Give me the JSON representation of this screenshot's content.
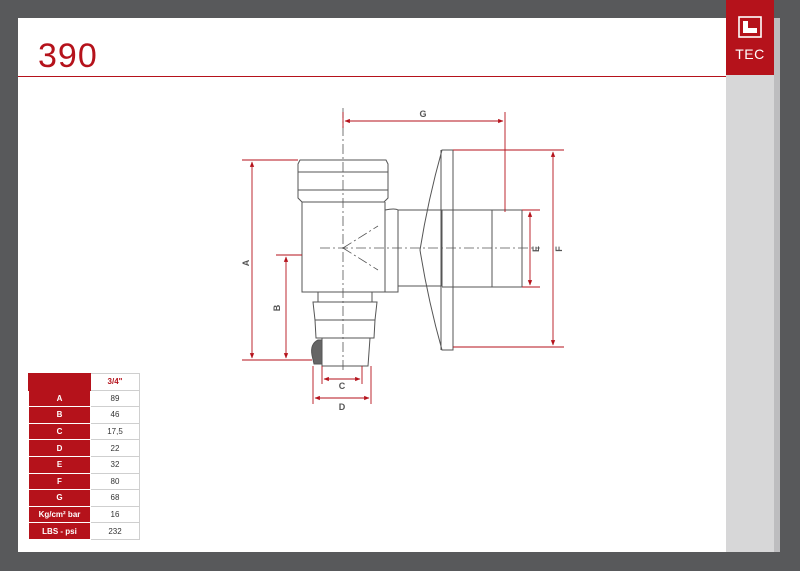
{
  "header": {
    "product_code": "390"
  },
  "brand": {
    "name": "TEC",
    "logo_icon": "tec-logo-icon"
  },
  "drawing": {
    "labels": {
      "A": "A",
      "B": "B",
      "C": "C",
      "D": "D",
      "E": "E",
      "F": "F",
      "G": "G"
    }
  },
  "spec_table": {
    "size_header": "3/4\"",
    "rows": [
      {
        "label": "A",
        "value": "89"
      },
      {
        "label": "B",
        "value": "46"
      },
      {
        "label": "C",
        "value": "17,5"
      },
      {
        "label": "D",
        "value": "22"
      },
      {
        "label": "E",
        "value": "32"
      },
      {
        "label": "F",
        "value": "80"
      },
      {
        "label": "G",
        "value": "68"
      },
      {
        "label": "Kg/cm² bar",
        "value": "16"
      },
      {
        "label": "LBS - psi",
        "value": "232"
      }
    ]
  },
  "colors": {
    "accent": "#b5121b",
    "frame": "#58595b",
    "sidebar": "#d7d7d8"
  }
}
